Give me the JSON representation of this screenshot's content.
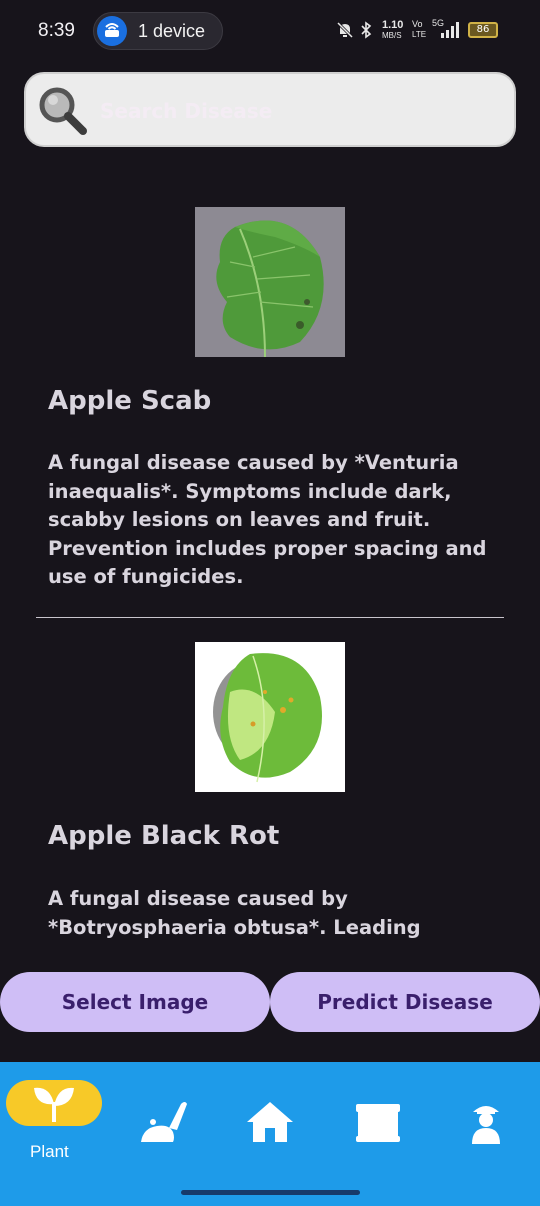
{
  "status_bar": {
    "time": "8:39",
    "device_label": "1 device",
    "speed_value": "1.10",
    "speed_unit": "MB/S",
    "volte_top": "Vo",
    "volte_bottom": "LTE",
    "network": "5G",
    "battery": "86"
  },
  "search": {
    "placeholder": "Search Disease",
    "icon": "search-icon"
  },
  "diseases": [
    {
      "title": "Apple Scab",
      "description": "A fungal disease caused by *Venturia inaequalis*. Symptoms include dark, scabby lesions on leaves and fruit. Prevention includes proper spacing and use of fungicides.",
      "image": "green-apple-leaf-photo"
    },
    {
      "title": "Apple Black Rot",
      "description": "A fungal disease caused by *Botryosphaeria obtusa*. Leading",
      "image": "spotted-apple-leaf-photo"
    }
  ],
  "actions": {
    "select_image": "Select Image",
    "predict_disease": "Predict Disease"
  },
  "nav": {
    "items": [
      {
        "label": "Plant",
        "icon": "plant-sprout-icon",
        "active": true
      },
      {
        "icon": "watering-icon"
      },
      {
        "icon": "home-icon"
      },
      {
        "icon": "shop-icon"
      },
      {
        "icon": "farmer-profile-icon"
      }
    ]
  },
  "colors": {
    "background": "#17141b",
    "button": "#cfbef6",
    "button_text": "#3a1f6c",
    "nav_bar": "#1e9be9",
    "nav_active": "#f7c928"
  }
}
